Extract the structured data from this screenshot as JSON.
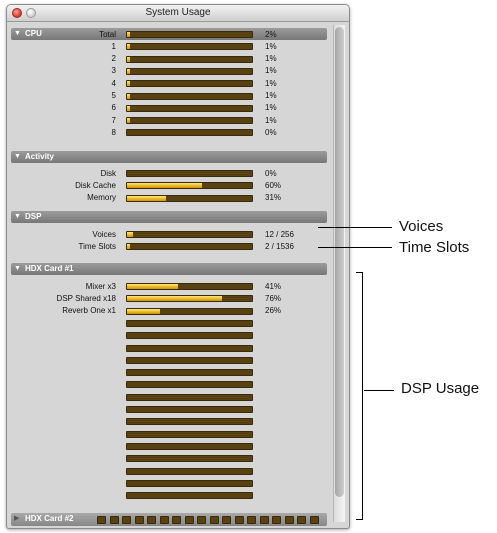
{
  "window": {
    "title": "System Usage"
  },
  "sections": {
    "cpu": {
      "name": "CPU",
      "rows": [
        {
          "label": "Total",
          "value": "2%",
          "fill": 0.02
        },
        {
          "label": "1",
          "value": "1%",
          "fill": 0.01
        },
        {
          "label": "2",
          "value": "1%",
          "fill": 0.01
        },
        {
          "label": "3",
          "value": "1%",
          "fill": 0.01
        },
        {
          "label": "4",
          "value": "1%",
          "fill": 0.01
        },
        {
          "label": "5",
          "value": "1%",
          "fill": 0.01
        },
        {
          "label": "6",
          "value": "1%",
          "fill": 0.01
        },
        {
          "label": "7",
          "value": "1%",
          "fill": 0.01
        },
        {
          "label": "8",
          "value": "0%",
          "fill": 0.0
        }
      ]
    },
    "activity": {
      "name": "Activity",
      "rows": [
        {
          "label": "Disk",
          "value": "0%",
          "fill": 0.0
        },
        {
          "label": "Disk Cache",
          "value": "60%",
          "fill": 0.6
        },
        {
          "label": "Memory",
          "value": "31%",
          "fill": 0.31
        }
      ]
    },
    "dsp": {
      "name": "DSP",
      "rows": [
        {
          "label": "Voices",
          "value": "12 / 256",
          "fill": 0.047
        },
        {
          "label": "Time Slots",
          "value": "2 / 1536",
          "fill": 0.001
        }
      ]
    },
    "hdx1": {
      "name": "HDX Card #1",
      "rows": [
        {
          "label": "Mixer x3",
          "value": "41%",
          "fill": 0.41
        },
        {
          "label": "DSP Shared x18",
          "value": "76%",
          "fill": 0.76
        },
        {
          "label": "Reverb One x1",
          "value": "26%",
          "fill": 0.26
        }
      ],
      "empty_bars": 15
    },
    "hdx2": {
      "name": "HDX Card #2",
      "mini_bars": 18
    }
  },
  "callouts": {
    "voices": "Voices",
    "time_slots": "Time Slots",
    "dsp_usage": "DSP Usage"
  },
  "colors": {
    "bar_empty": "#584112",
    "bar_fill": "#e7b31d",
    "header": "#888888"
  }
}
